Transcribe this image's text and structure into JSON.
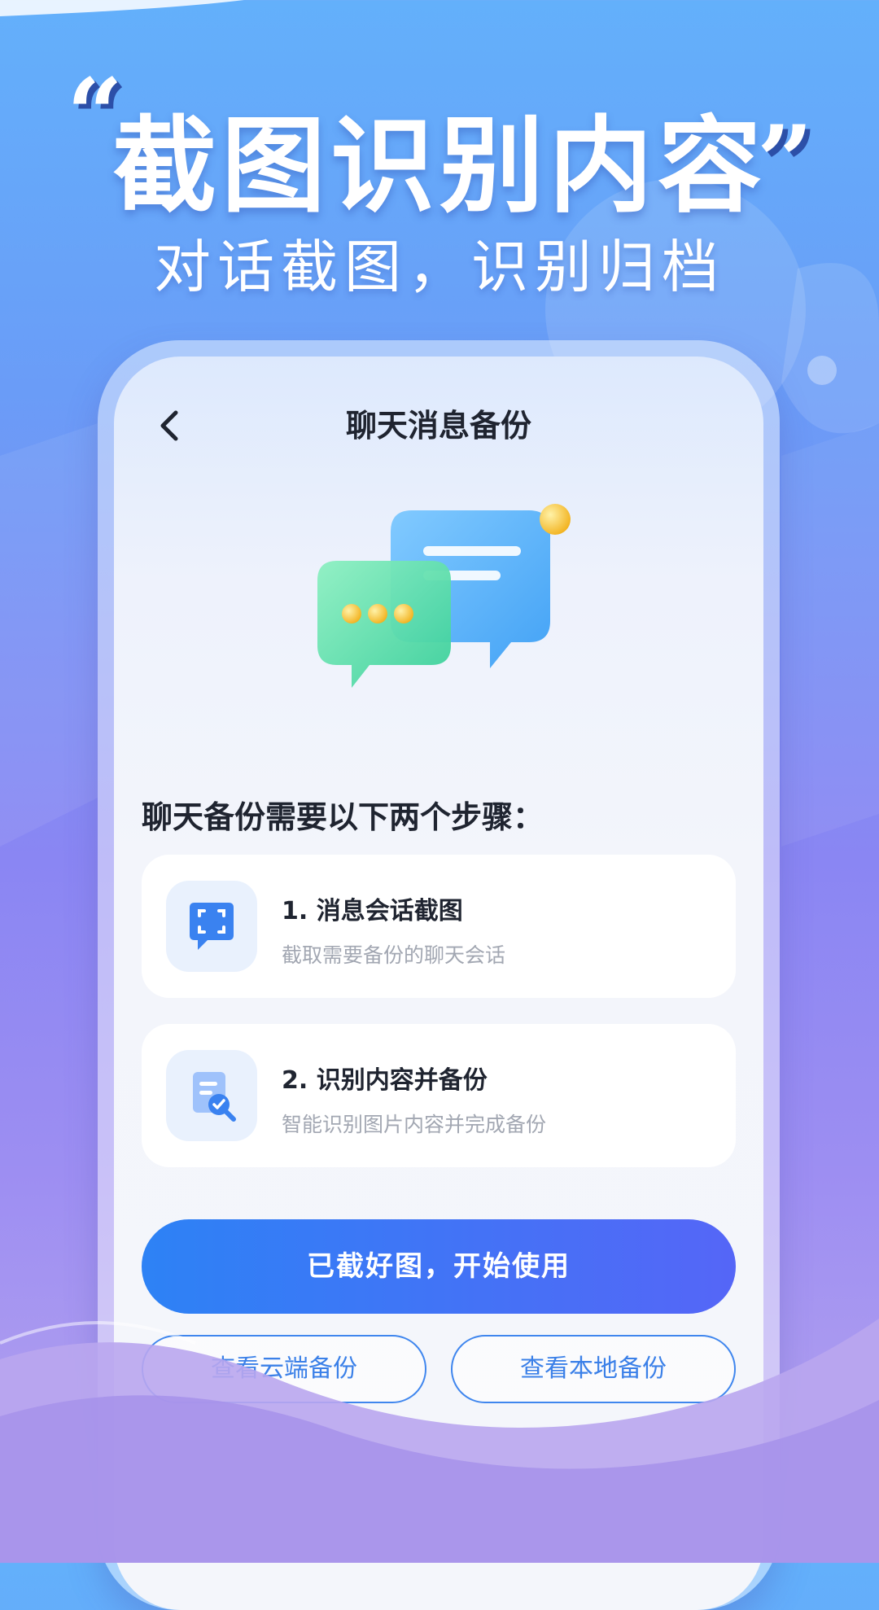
{
  "headline": {
    "quote_open": "“",
    "title": "截图识别内容",
    "quote_close": "”",
    "subtitle": "对话截图，识别归档"
  },
  "nav": {
    "back_icon": "chevron-left-icon",
    "title": "聊天消息备份"
  },
  "hero": {
    "icon": "chat-bubbles-illustration"
  },
  "steps": {
    "heading": "聊天备份需要以下两个步骤：",
    "items": [
      {
        "icon": "screenshot-chat-icon",
        "title": "1. 消息会话截图",
        "desc": "截取需要备份的聊天会话"
      },
      {
        "icon": "document-search-icon",
        "title": "2. 识别内容并备份",
        "desc": "智能识别图片内容并完成备份"
      }
    ]
  },
  "actions": {
    "primary": "已截好图，开始使用",
    "cloud_backup": "查看云端备份",
    "local_backup": "查看本地备份"
  },
  "colors": {
    "accent_blue": "#2d82f5",
    "accent_purple": "#5566f7",
    "outline_blue": "#3f86ee"
  }
}
